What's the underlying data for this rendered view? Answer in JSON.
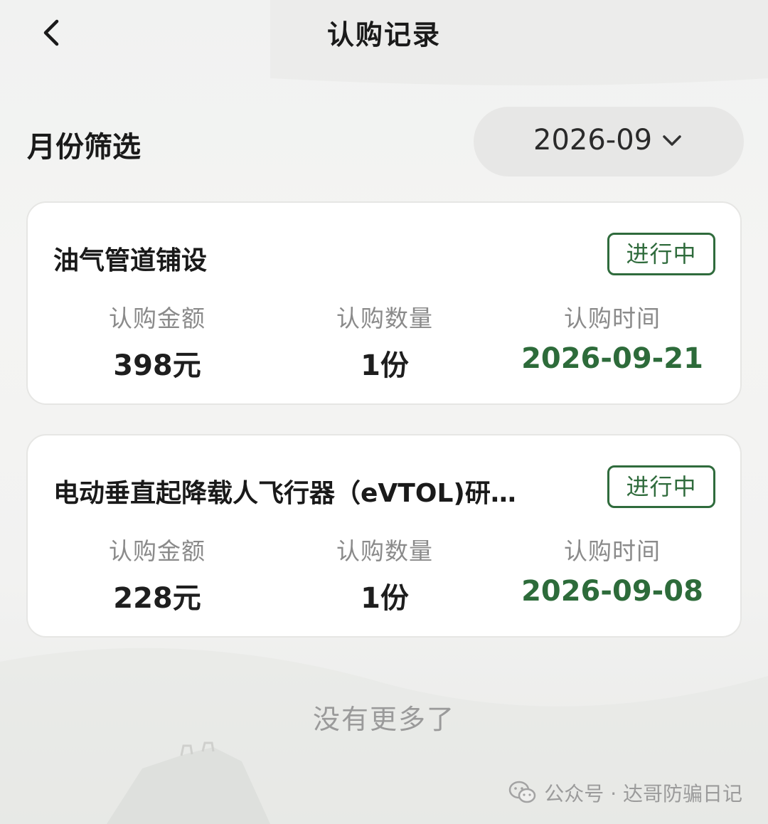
{
  "header": {
    "title": "认购记录",
    "back_icon": "chevron-left-icon"
  },
  "filter": {
    "label": "月份筛选",
    "selected_month": "2026-09",
    "dropdown_icon": "chevron-down-icon"
  },
  "records": [
    {
      "name": "油气管道铺设",
      "status": "进行中",
      "amount_label": "认购金额",
      "amount": "398元",
      "quantity_label": "认购数量",
      "quantity": "1份",
      "time_label": "认购时间",
      "time": "2026-09-21"
    },
    {
      "name": "电动垂直起降载人飞行器（eVTOL)研…",
      "status": "进行中",
      "amount_label": "认购金额",
      "amount": "228元",
      "quantity_label": "认购数量",
      "quantity": "1份",
      "time_label": "认购时间",
      "time": "2026-09-08"
    }
  ],
  "footer": {
    "no_more": "没有更多了"
  },
  "watermark": {
    "text": "公众号 · 达哥防骗日记",
    "icon": "wechat-icon"
  },
  "colors": {
    "accent_green": "#2d6b3a",
    "badge_green": "#2f6b3c",
    "muted_text": "#8a8a8a",
    "card_bg": "#ffffff",
    "select_bg": "#e7e7e6"
  }
}
